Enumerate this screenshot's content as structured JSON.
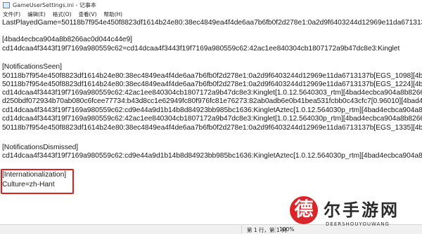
{
  "window": {
    "title": "GameUserSettings.ini - 记事本"
  },
  "menu": [
    "文件(F)",
    "编辑(E)",
    "格式(O)",
    "查看(V)",
    "帮助(H)"
  ],
  "editor": {
    "lines": [
      "LastPlayedGame=50118b7f954e450f8823df1614b24e80:38ec4849ea4f4de6aa7b6fb0f2d278e1:0a2d9f6403244d12969e11da6713137b",
      "",
      "[4bad4ecbca904a8b8266ac0d044c44e9]",
      "cd14dcaa4f3443f19f7169a980559c62=cd14dcaa4f3443f19f7169a980559c62:42ac1ee840304cb1807172a9b47dc8e3:Kinglet",
      "",
      "[NotificationsSeen]",
      "50118b7f954e450f8823df1614b24e80:38ec4849ea4f4de6aa7b6fb0f2d278e1:0a2d9f6403244d12969e11da6713137b[EGS_1098][4bad4ecbca904a8b8266",
      "50118b7f954e450f8823df1614b24e80:38ec4849ea4f4de6aa7b6fb0f2d278e1:0a2d9f6403244d12969e11da6713137b[EGS_1224][4bad4ecbca904a8b8266",
      "cd14dcaa4f3443f19f7169a980559c62:42ac1ee840304cb1807172a9b47dc8e3:Kinglet[1.0.12.5640303_rtm][4bad4ecbca904a8b8266ac0d044c44e9]",
      "d250bdf072934b70ab080c6fcee77734:b43d8cc1e62949fc80f976fc81e76273:82ab0adb6e0b41bea531fcbb0c43cfc7[0.96010][4bad4ecbca904a8b82",
      "cd14dcaa4f3443f19f7169a980559c62:cd9e44a9d1b14b8d84923bb985bc1636:KingletAztec[1.0.12.564030p_rtm][4bad4ecbca904a8b8266ac0d044c",
      "cd14dcaa4f3443f19f7169a980559c62:42ac1ee840304cb1807172a9b47dc8e3:Kinglet[1.0.12.564030p_rtm][4bad4ecbca904a8b8266ac0d044c44e9]",
      "50118b7f954e450f8823df1614b24e80:38ec4849ea4f4de6aa7b6fb0f2d278e1:0a2d9f6403244d12969e11da6713137b[EGS_1335][4bad4ecbca904a8b8266",
      "",
      "[NotificationsDismissed]",
      "cd14dcaa4f3443f19f7169a980559c62:cd9e44a9d1b14b8d84923bb985bc1636:KingletAztec[1.0.12.564030p_rtm][4bad4ecbca904a8b8266ac0d044c",
      "",
      "[Internationalization]",
      "Culture=zh-Hant"
    ]
  },
  "statusbar": {
    "position": "第 1 行，第 1 列",
    "zoom": "100%"
  },
  "watermark": {
    "mark": "德",
    "title": "尔手游网",
    "subtitle": "DEERSHOUYOUWANG"
  },
  "colors": {
    "highlight": "#e0211b",
    "badge": "#d8262b"
  }
}
